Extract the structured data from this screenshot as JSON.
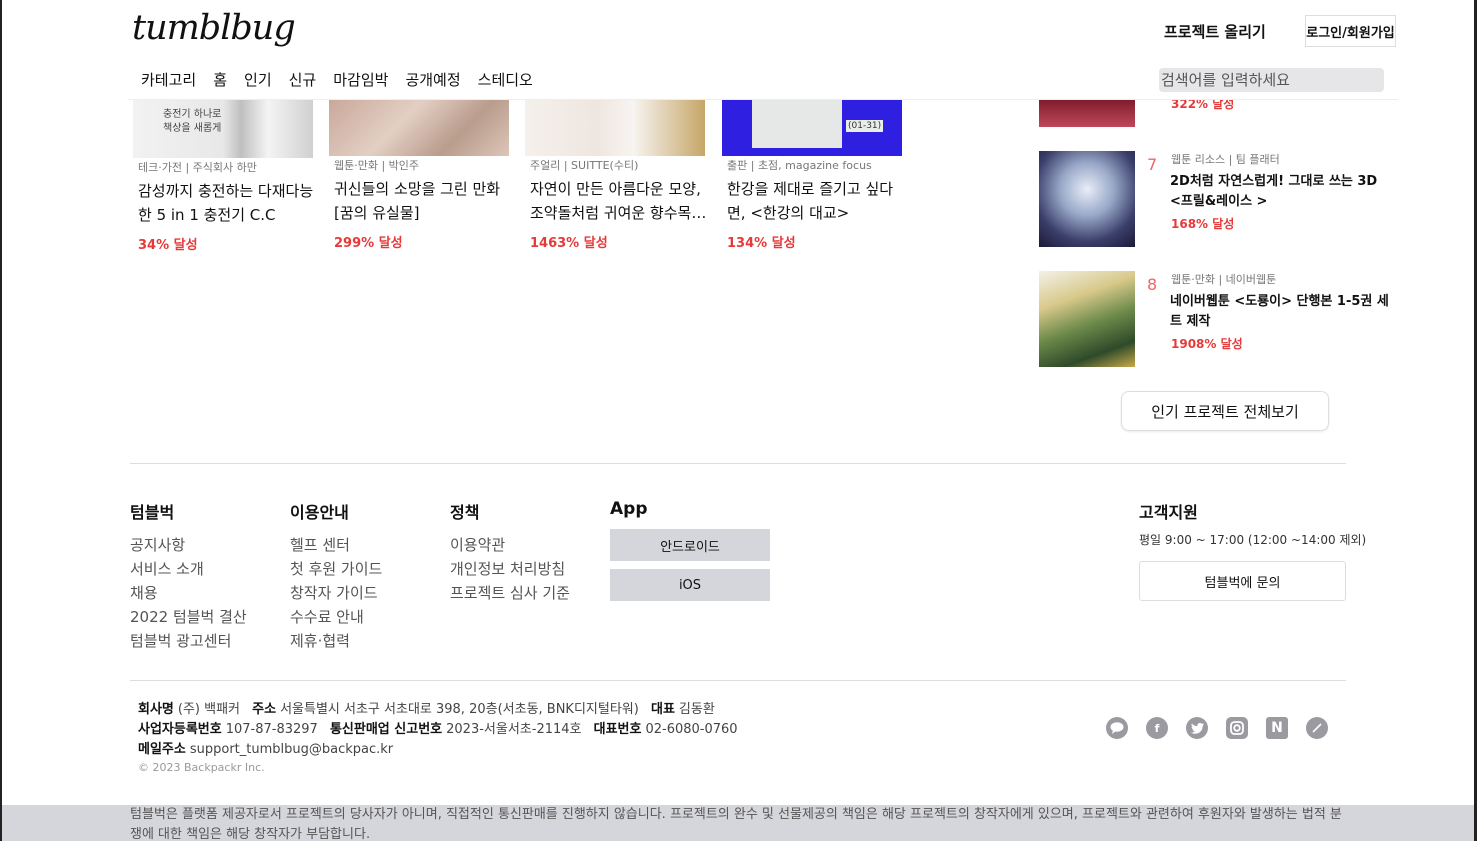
{
  "header": {
    "logo": "tumblbug",
    "upload_label": "프로젝트 올리기",
    "login_label": "로그인/회원가입",
    "nav": [
      "카테고리",
      "홈",
      "인기",
      "신규",
      "마감임박",
      "공개예정",
      "스테디오"
    ],
    "search_placeholder": "검색어를 입력하세요"
  },
  "cards": [
    {
      "thumb_text": "충전기 하나로 책상을 새롭게",
      "category": "테크·가전 | 주식회사 하만",
      "title": "감성까지 충전하는 다재다능한 5 in 1 충전기 C.C",
      "rate": "34% 달성"
    },
    {
      "category": "웹툰·만화 | 박인주",
      "title": "귀신들의 소망을 그린 만화 [꿈의 유실물]",
      "rate": "299% 달성"
    },
    {
      "category": "주얼리 | SUITTE(수티)",
      "title": "자연이 만든 아름다운 모양, 조약돌처럼 귀여운 향수목…",
      "rate": "1463% 달성"
    },
    {
      "thumb_text": "(01-31)",
      "category": "출판 | 초점, magazine focus",
      "title": "한강을 제대로 즐기고 싶다면, <한강의 대교>",
      "rate": "134% 달성"
    }
  ],
  "ranking": {
    "partial_rate": "322% 달성",
    "items": [
      {
        "rank": "7",
        "category": "웹툰 리소스 | 팀 플래터",
        "title": "2D처럼 자연스럽게! 그대로 쓰는 3D <프릴&레이스 >",
        "rate": "168% 달성"
      },
      {
        "rank": "8",
        "category": "웹툰·만화 | 네이버웹툰",
        "title": "네이버웹툰 <도룡이> 단행본 1-5권 세트 제작",
        "rate": "1908% 달성"
      }
    ],
    "more_label": "인기 프로젝트 전체보기"
  },
  "footer": {
    "columns": [
      {
        "title": "텀블벅",
        "links": [
          "공지사항",
          "서비스 소개",
          "채용",
          "2022 텀블벅 결산",
          "텀블벅 광고센터"
        ]
      },
      {
        "title": "이용안내",
        "links": [
          "헬프 센터",
          "첫 후원 가이드",
          "창작자 가이드",
          "수수료 안내",
          "제휴·협력"
        ]
      },
      {
        "title": "정책",
        "links": [
          "이용약관",
          "개인정보 처리방침",
          "프로젝트 심사 기준"
        ]
      }
    ],
    "app": {
      "title": "App",
      "android": "안드로이드",
      "ios": "iOS"
    },
    "support": {
      "title": "고객지원",
      "hours": "평일 9:00 ~ 17:00 (12:00 ~14:00 제외)",
      "contact_label": "텀블벅에 문의"
    },
    "company": {
      "name_label": "회사명",
      "name": "(주) 백패커",
      "address_label": "주소",
      "address": "서울특별시 서초구 서초대로 398, 20층(서초동, BNK디지털타워)",
      "ceo_label": "대표",
      "ceo": "김동환",
      "biz_label": "사업자등록번호",
      "biz": "107-87-83297",
      "mail_order_label": "통신판매업 신고번호",
      "mail_order": "2023-서울서초-2114호",
      "phone_label": "대표번호",
      "phone": "02-6080-0760",
      "email_label": "메일주소",
      "email": "support_tumblbug@backpac.kr",
      "copyright": "© 2023 Backpackr Inc."
    },
    "social_icons": [
      "kakao-icon",
      "facebook-icon",
      "twitter-icon",
      "instagram-icon",
      "naver-icon",
      "brunch-icon"
    ],
    "disclaimer": "텀블벅은 플랫폼 제공자로서 프로젝트의 당사자가 아니며, 직접적인 통신판매를 진행하지 않습니다. 프로젝트의 완수 및 선물제공의 책임은 해당 프로젝트의 창작자에게 있으며, 프로젝트와 관련하여 후원자와 발생하는 법적 분쟁에 대한 책임은 해당 창작자가 부담합니다."
  },
  "colors": {
    "accent_red": "#e63a3a",
    "rank_number": "#ee6666",
    "button_gray": "#d5d6db"
  }
}
